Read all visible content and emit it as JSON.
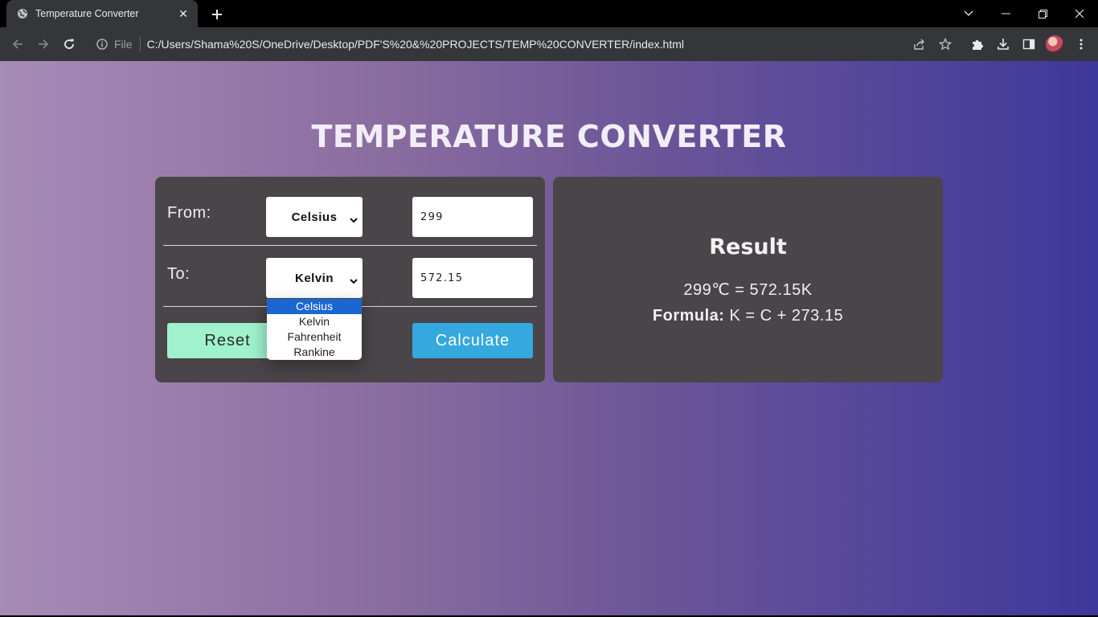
{
  "browser": {
    "tab_title": "Temperature Converter",
    "tab_close": "✕",
    "new_tab": "+",
    "omnibox_file_label": "File",
    "url": "C:/Users/Shama%20S/OneDrive/Desktop/PDF'S%20&%20PROJECTS/TEMP%20CONVERTER/index.html"
  },
  "page": {
    "title": "TEMPERATURE CONVERTER",
    "from_label": "From:",
    "to_label": "To:",
    "from_unit": "Celsius",
    "to_unit": "Kelvin",
    "input_value": "299",
    "output_value": "572.15",
    "reset_label": "Reset",
    "calculate_label": "Calculate",
    "dropdown_options": [
      "Celsius",
      "Kelvin",
      "Fahrenheit",
      "Rankine"
    ],
    "dropdown_highlighted": "Celsius"
  },
  "result": {
    "title": "Result",
    "equation": "299℃ = 572.15K",
    "formula_label": "Formula:",
    "formula": "K = C + 273.15"
  },
  "colors": {
    "reset_button": "#9ff2cd",
    "calculate_button": "#35a9df",
    "panel": "#4a4549",
    "dropdown_highlight": "#1a67d2"
  }
}
